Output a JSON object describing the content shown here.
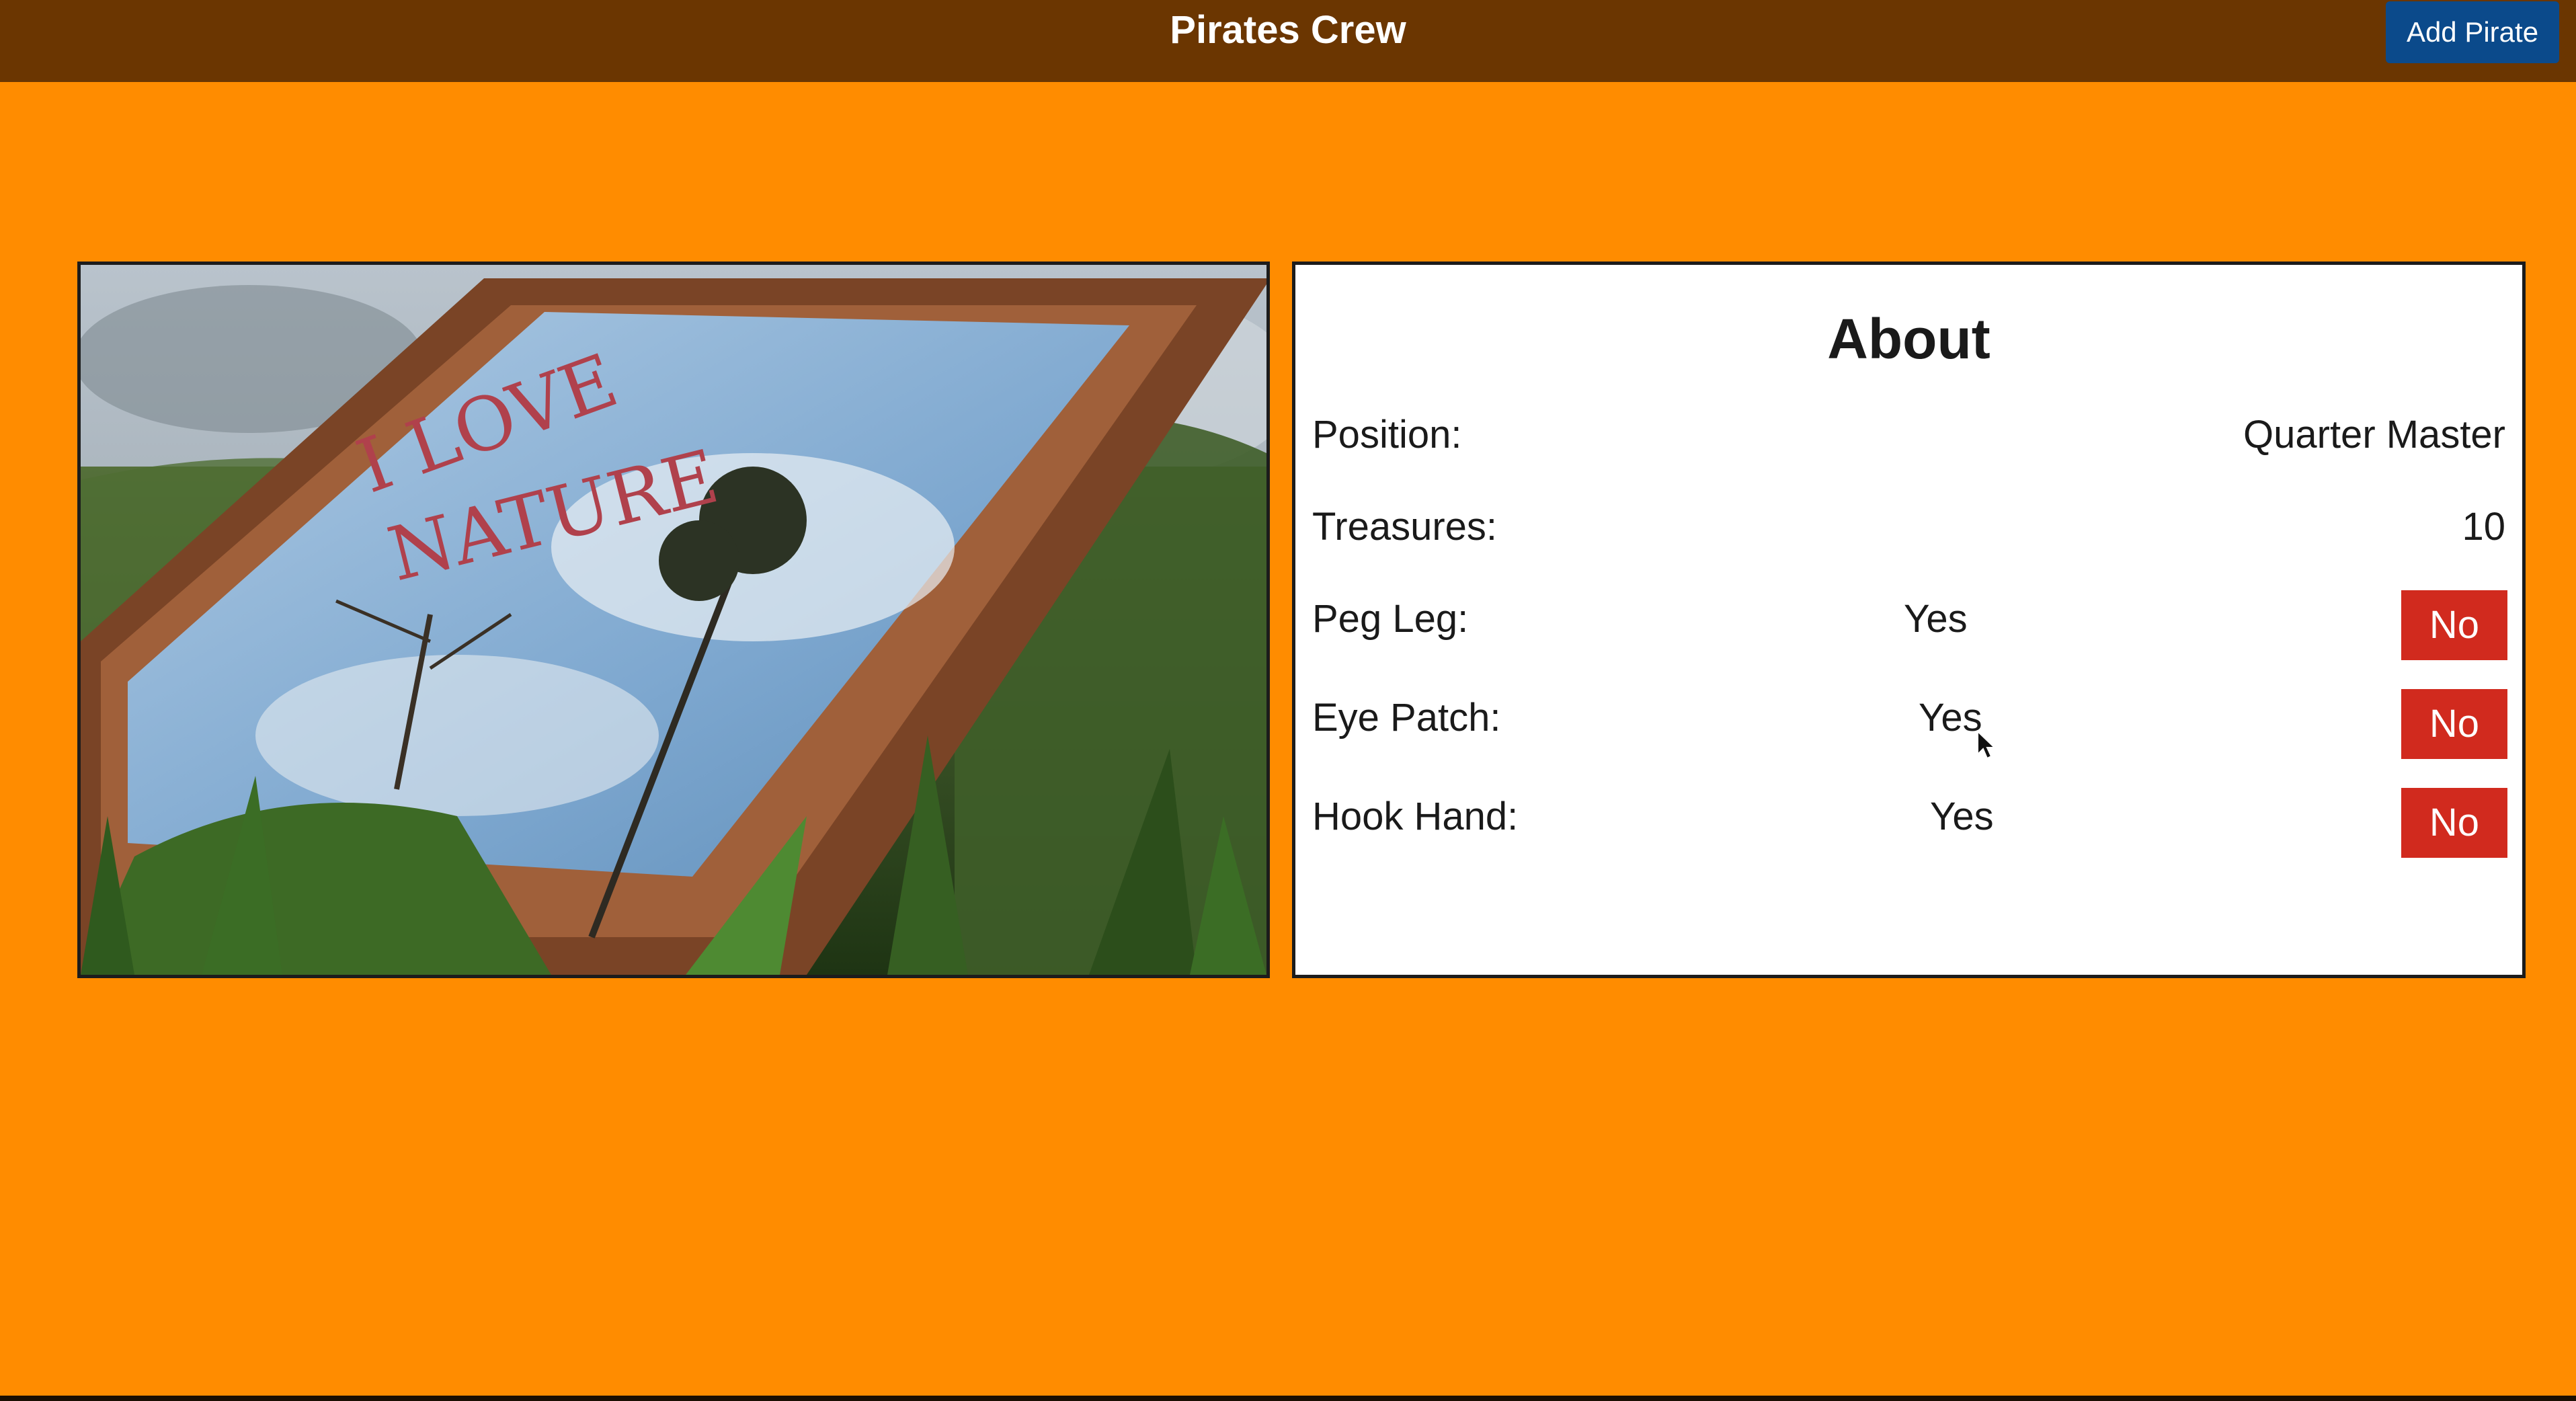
{
  "header": {
    "title": "Pirates Crew",
    "add_button_label": "Add Pirate"
  },
  "image": {
    "alt": "Framed mirror in grass with handwritten words",
    "overlay_text_line1": "I LOVE",
    "overlay_text_line2": "NATURE"
  },
  "about": {
    "title": "About",
    "rows": [
      {
        "label": "Position:",
        "value": "Quarter Master"
      },
      {
        "label": "Treasures:",
        "value": "10"
      },
      {
        "label": "Peg Leg:",
        "yes_label": "Yes",
        "no_label": "No"
      },
      {
        "label": "Eye Patch:",
        "yes_label": "Yes",
        "no_label": "No"
      },
      {
        "label": "Hook Hand:",
        "yes_label": "Yes",
        "no_label": "No"
      }
    ]
  },
  "colors": {
    "page_bg": "#FF8C00",
    "header_bg": "#6B3601",
    "add_button_bg": "#0B4A8B",
    "no_button_bg": "#D12A1E"
  },
  "icons": {
    "cursor": "mouse-pointer-icon"
  }
}
